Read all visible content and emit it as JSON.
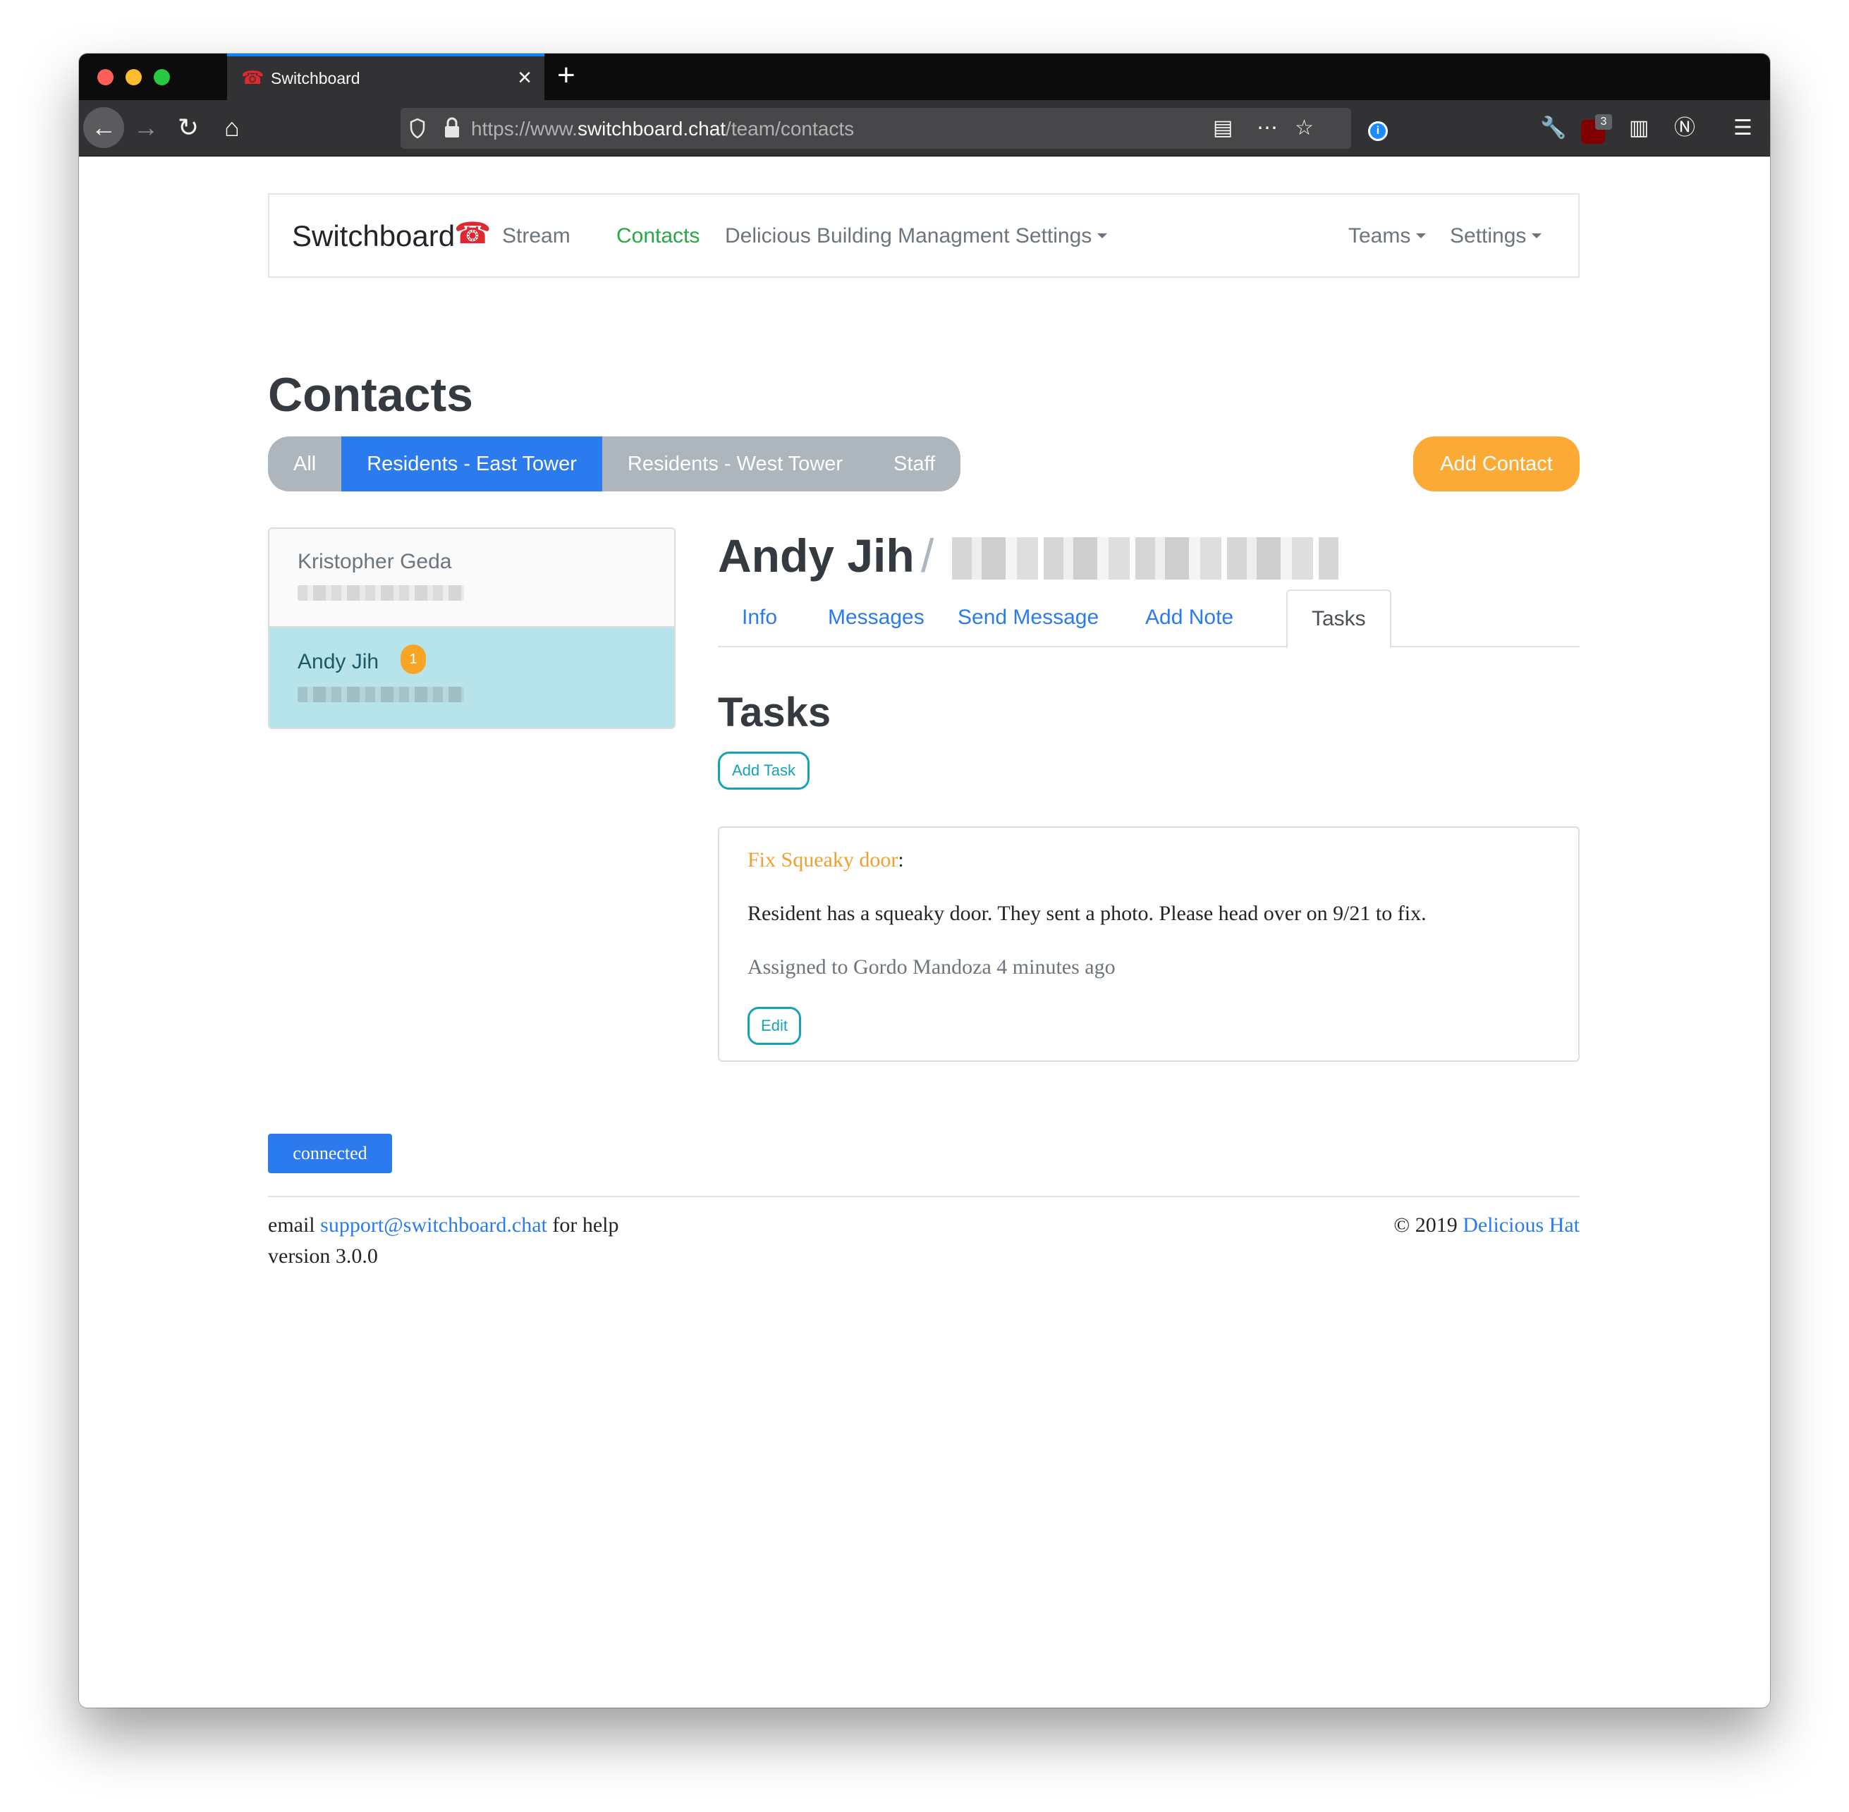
{
  "browser": {
    "tab_title": "Switchboard",
    "tab_favicon": "telephone-icon",
    "url_prefix": "https://www.",
    "url_host": "switchboard.chat",
    "url_path": "/team/contacts",
    "ublock_count": "3"
  },
  "navbar": {
    "brand": "Switchboard",
    "brand_icon": "telephone-icon",
    "links": {
      "stream": "Stream",
      "contacts": "Contacts",
      "building_settings": "Delicious Building Managment Settings",
      "teams": "Teams",
      "settings": "Settings"
    }
  },
  "page_title": "Contacts",
  "filters": [
    "All",
    "Residents - East Tower",
    "Residents - West Tower",
    "Staff"
  ],
  "active_filter": "Residents - East Tower",
  "add_contact_label": "Add Contact",
  "contacts": [
    {
      "name": "Kristopher Geda",
      "badge": ""
    },
    {
      "name": "Andy Jih",
      "badge": "1"
    }
  ],
  "detail": {
    "name": "Andy Jih",
    "separator": "/",
    "tabs": [
      "Info",
      "Messages",
      "Send Message",
      "Add Note",
      "Tasks"
    ],
    "active_tab": "Tasks",
    "section_title": "Tasks",
    "add_task_label": "Add Task",
    "task": {
      "title": "Fix Squeaky door",
      "title_suffix": ":",
      "body": "Resident has a squeaky door. They sent a photo. Please head over on 9/21 to fix.",
      "meta": "Assigned to Gordo Mandoza 4 minutes ago",
      "edit_label": "Edit"
    }
  },
  "status": "connected",
  "footer": {
    "email_prefix": "email ",
    "email": "support@switchboard.chat",
    "email_suffix": " for help",
    "version": "version 3.0.0",
    "copyright": "© 2019 ",
    "company": "Delicious Hat"
  },
  "colors": {
    "primary": "#2b7bef",
    "success": "#28a745",
    "warning": "#fbab35",
    "info": "#17a2b8",
    "active_row": "#b6e4ea"
  }
}
